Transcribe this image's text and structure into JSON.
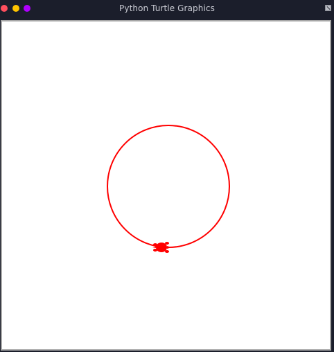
{
  "window": {
    "title": "Python Turtle Graphics"
  },
  "controls": {
    "close_icon": "close-dot",
    "minimize_icon": "minimize-dot",
    "maximize_icon": "maximize-dot",
    "corner_icon": "restore-icon"
  },
  "colors": {
    "close": "#ff4f5e",
    "minimize": "#ffc400",
    "maximize": "#b000ff",
    "pen": "#ff0000",
    "turtle": "#ff0000"
  },
  "drawing": {
    "shape": "circle",
    "pen_color": "red",
    "turtle_shape": "turtle"
  }
}
